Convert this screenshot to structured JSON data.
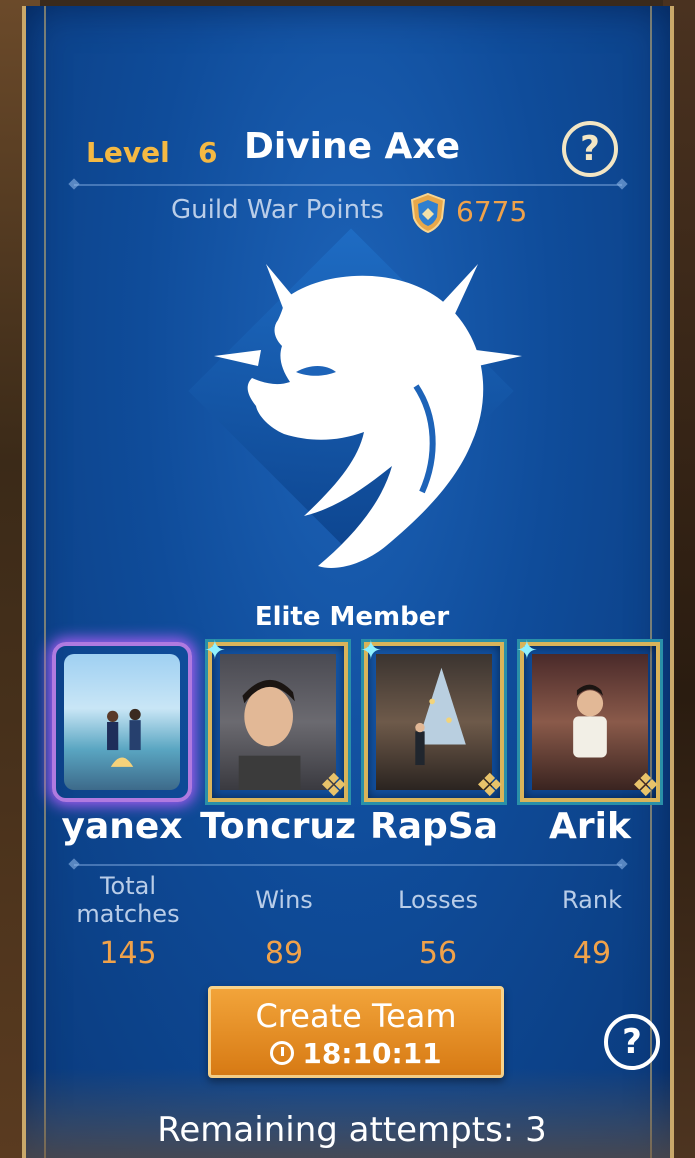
{
  "header": {
    "level_label": "Level",
    "level_value": "6",
    "guild_name": "Divine Axe",
    "help_glyph": "?"
  },
  "guild_war": {
    "label": "Guild War Points",
    "value": "6775",
    "icon": "shield-icon"
  },
  "emblem": {
    "icon": "wolf-emblem-icon"
  },
  "elite": {
    "label": "Elite Member",
    "members": [
      {
        "name": "yanex",
        "frame": "purple"
      },
      {
        "name": "Toncruz",
        "frame": "gold"
      },
      {
        "name": "RapSa",
        "frame": "gold"
      },
      {
        "name": "Arik",
        "frame": "gold"
      }
    ]
  },
  "stats": [
    {
      "label": "Total matches",
      "value": "145"
    },
    {
      "label": "Wins",
      "value": "89"
    },
    {
      "label": "Losses",
      "value": "56"
    },
    {
      "label": "Rank",
      "value": "49"
    }
  ],
  "create_team": {
    "label": "Create Team",
    "timer": "18:10:11"
  },
  "footer": {
    "remaining": "Remaining attempts: 3"
  },
  "colors": {
    "panel": "#0f4c9a",
    "accent_gold": "#f4b943",
    "value_orange": "#f0a24a",
    "button": "#e08a22"
  }
}
